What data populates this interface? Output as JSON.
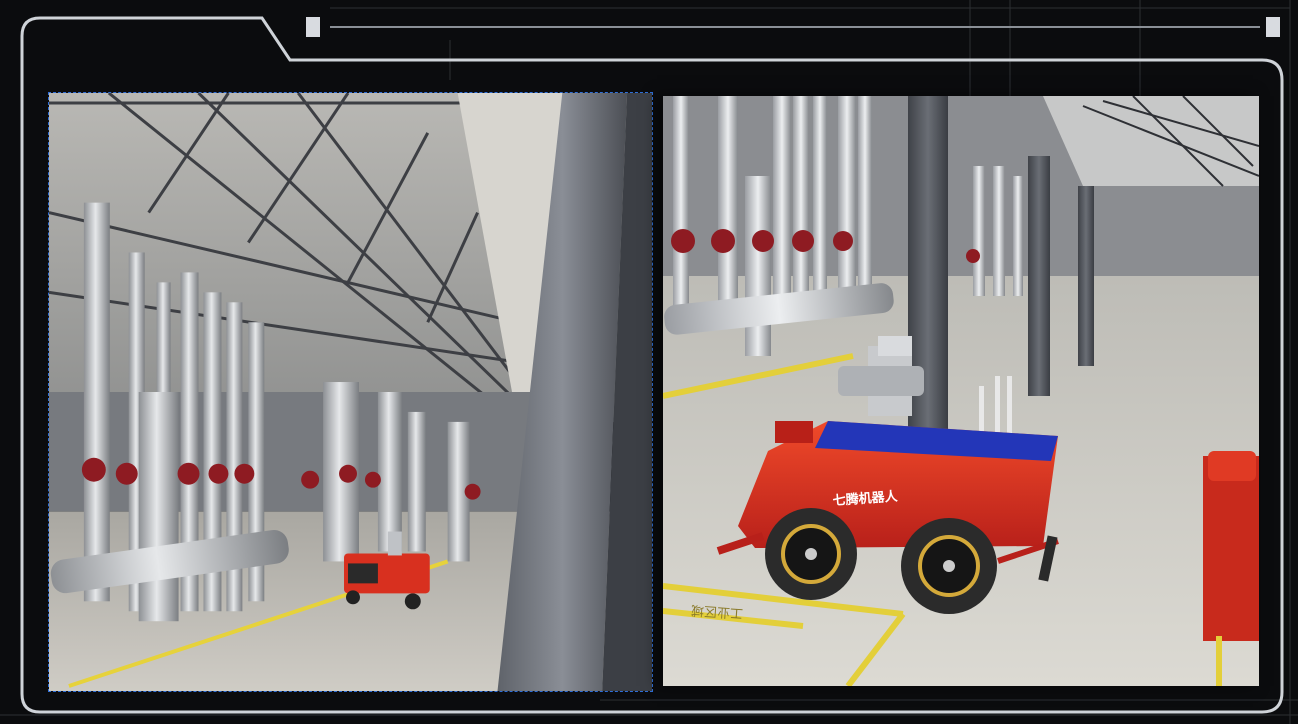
{
  "scene": {
    "description_tags": [
      "industrial-hall",
      "insulated-pipes",
      "inspection-robot"
    ]
  },
  "robot": {
    "brand_text": "七腾机器人",
    "body_color": "#e8321c",
    "top_color": "#2336b8"
  },
  "floor_marking": {
    "text": "工业区域"
  },
  "colors": {
    "frame": "#cfd3d8",
    "accent_blue": "#2f6fd8",
    "floor": "#cfd0cc",
    "pipe": "#c9ccd0",
    "valve": "#8e1b22"
  }
}
